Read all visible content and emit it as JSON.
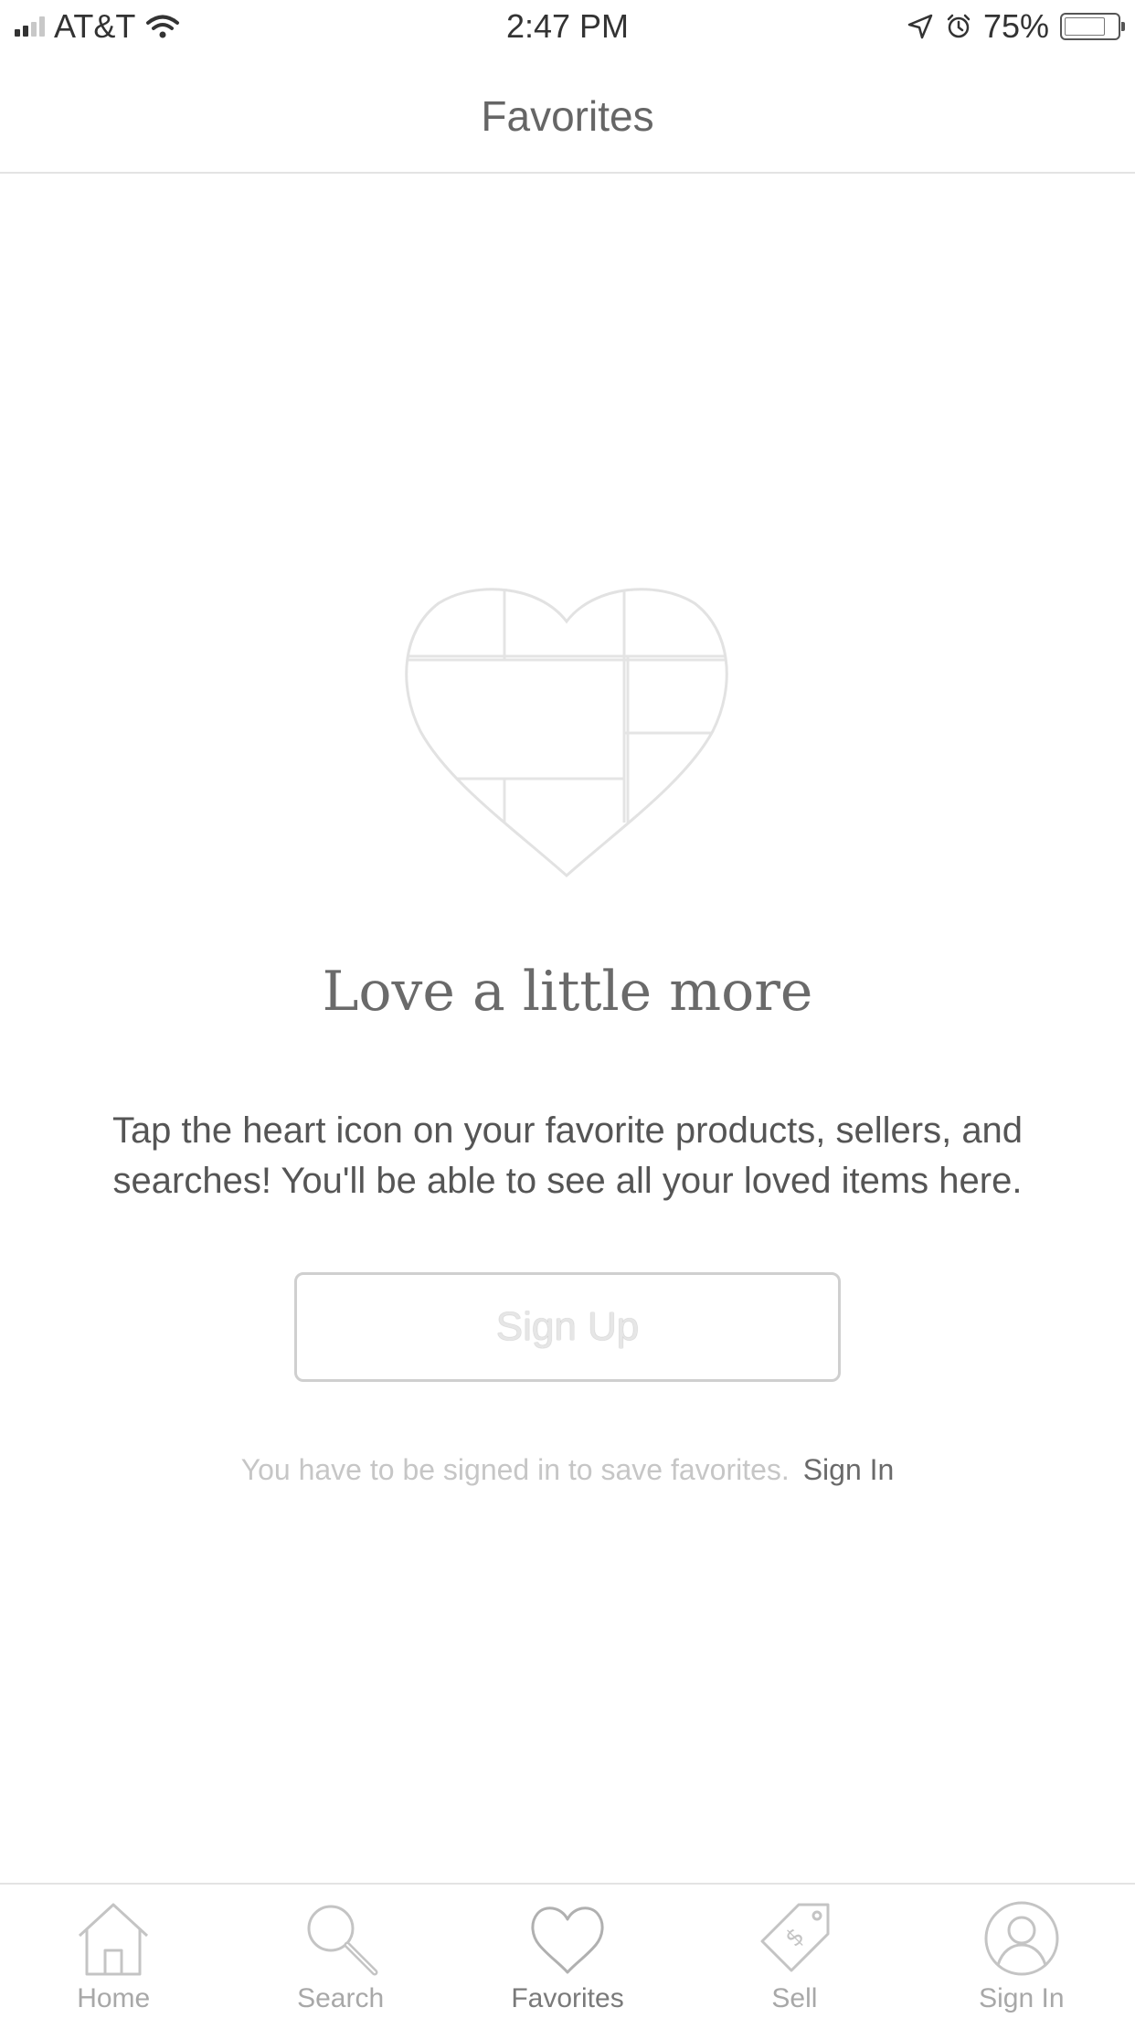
{
  "status_bar": {
    "carrier": "AT&T",
    "time": "2:47 PM",
    "battery": "75%",
    "battery_level": 0.75
  },
  "header": {
    "title": "Favorites"
  },
  "empty_state": {
    "icon": "heart-collage-icon",
    "headline": "Love a little more",
    "description": "Tap the heart icon on your favorite products, sellers, and searches! You'll be able to see all your loved items here.",
    "signup_label": "Sign Up",
    "signin_note": "You have to be signed in to save favorites.",
    "signin_link": "Sign In"
  },
  "tab_bar": {
    "tabs": [
      {
        "label": "Home",
        "icon": "home-icon"
      },
      {
        "label": "Search",
        "icon": "search-icon"
      },
      {
        "label": "Favorites",
        "icon": "heart-icon",
        "active": true
      },
      {
        "label": "Sell",
        "icon": "price-tag-icon"
      },
      {
        "label": "Sign In",
        "icon": "user-icon"
      }
    ]
  }
}
